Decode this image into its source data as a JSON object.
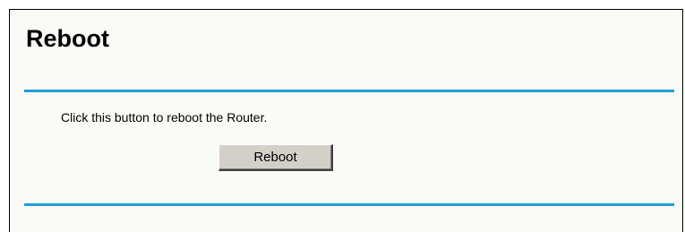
{
  "page": {
    "title": "Reboot",
    "instruction": "Click this button to reboot the Router.",
    "reboot_button_label": "Reboot"
  },
  "colors": {
    "panel_background": "#fbfbf5",
    "separator": "#1e9fd6",
    "button_face": "#d4d0c8"
  }
}
